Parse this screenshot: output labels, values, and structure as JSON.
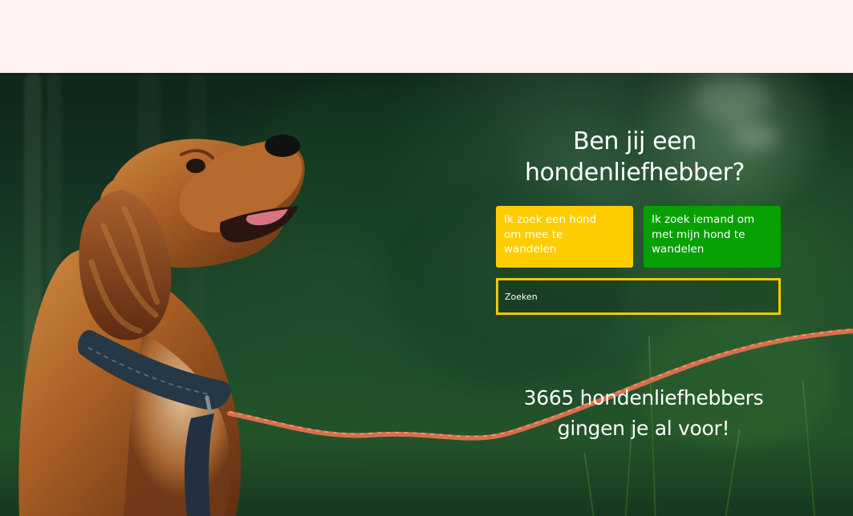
{
  "hero": {
    "title": "Ben jij een hondenliefhebber?",
    "choices": [
      {
        "label": "Ik zoek een hond om mee te wandelen",
        "color": "#ffcc00"
      },
      {
        "label": "Ik zoek iemand om met mijn hond te wandelen",
        "color": "#07a000"
      }
    ],
    "search": {
      "placeholder": "Zoeken",
      "border_color": "#f4c900"
    },
    "counter": "3665 hondenliefhebbers gingen je al voor!"
  },
  "colors": {
    "page_background": "#fff1f0",
    "text": "#ffffff"
  },
  "icons": {
    "hero_image": "dog-with-leash-photo"
  }
}
